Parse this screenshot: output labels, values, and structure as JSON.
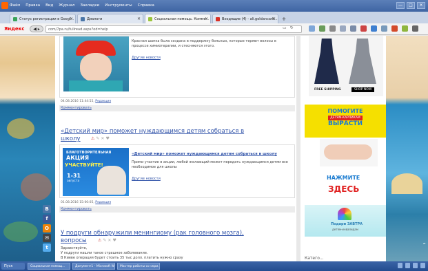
{
  "menubar": {
    "items": [
      "Файл",
      "Правка",
      "Вид",
      "Журнал",
      "Закладки",
      "Инструменты",
      "Справка"
    ],
    "window_buttons": [
      "—",
      "□",
      "✕"
    ]
  },
  "tabs": [
    {
      "label": "Статус регистрации в Googl...",
      "color": "#3aa35a",
      "active": false
    },
    {
      "label": "Диалоги",
      "color": "#4a76a8",
      "active": false
    },
    {
      "label": "Социальная помощь. Комме...",
      "color": "#9bc53d",
      "active": true
    },
    {
      "label": "Входящие (4) - ali.goldancark...",
      "color": "#d93025",
      "active": false
    }
  ],
  "newtab_label": "+",
  "address": {
    "brand": "Яндекс",
    "url": "com/7pa.ru/fullread.aspx?od=help",
    "nav_symbol": "◀ ▸"
  },
  "article1": {
    "text": "Красная шапка была создана в поддержку больных, которые теряют волосы в процессе химиотерапии, и стесняются этого.",
    "more_link": "Другие новости",
    "meta_date": "04.08.2016 11:44:55,",
    "meta_link": "Редакция",
    "comment": "Комментировать"
  },
  "article2": {
    "title": "«Детский мир» поможет нуждающимся детям собраться в школу",
    "promo_top": "БЛАГОТВОРИТЕЛЬНАЯ",
    "promo_main": "АКЦИЯ",
    "promo_join": "УЧАСТВУЙТЕ!",
    "promo_dates": "1-31",
    "promo_month": "августа",
    "inner_title": "«Детский мир» поможет нуждающимся детям собраться в школу",
    "text": "Прими участие в акции, любой желающий может передать нуждающимся детям все необходимое для школы",
    "more_link": "Другие новости",
    "meta_date": "01.08.2016 15:00:05,",
    "meta_link": "Редакция",
    "comment": "Комментировать"
  },
  "article3": {
    "title": "У подруги обнаружили менингиому (рак головного мозга), вопросы",
    "line1": "Здравствуйте,",
    "line2": "У подруги нашли такое страшное заболевание.",
    "line3": "В Киеве операция будет стоить 35 тыс долл. платить нужно сразу"
  },
  "sidebar": {
    "shipping": "FREE SHIPPING",
    "shop": "SHOP NOW",
    "help_title": "ПОМОГИТЕ",
    "help_sub": "ДЕТЯМ-КАРЛИКАМ",
    "help_grow": "ВЫРАСТИ",
    "click": "НАЖМИТЕ",
    "here": "ЗДЕСЬ",
    "logo_brand": "Подари ЗАВТРА",
    "logo_sub": "детям-инвалидам",
    "bottom_word": "Катего..."
  },
  "social_icons": [
    "В",
    "f",
    "O",
    "✉",
    "t"
  ],
  "taskbar": {
    "start": "Пуск",
    "apps": [
      "Социальная помощ...",
      "Документ1 - Microsoft W...",
      "Мастер работы со скри..."
    ]
  },
  "colors": {
    "link": "#3355aa",
    "accent_red": "#e02020",
    "ad_yellow": "#f5e000"
  }
}
